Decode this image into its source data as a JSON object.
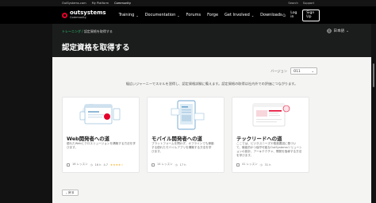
{
  "topbar": {
    "links": [
      "OutSystems.com",
      "My Platform",
      "Community"
    ],
    "right_links": [
      "Search",
      "Support"
    ]
  },
  "nav": {
    "logo_name": "outsystems",
    "logo_sub": "Community",
    "items": [
      {
        "label": "Training",
        "has_dropdown": true
      },
      {
        "label": "Documentation",
        "has_dropdown": true
      },
      {
        "label": "Forums",
        "has_dropdown": false
      },
      {
        "label": "Forge",
        "has_dropdown": false
      },
      {
        "label": "Get Involved",
        "has_dropdown": true
      },
      {
        "label": "Downloads",
        "has_dropdown": false
      }
    ],
    "login": "Log in",
    "signup": "Sign Up"
  },
  "subheader": {
    "breadcrumb_link": "トレーニング",
    "breadcrumb_sep": "/",
    "breadcrumb_current": "認定資格を取得する",
    "language": "日本語",
    "title": "認定資格を取得する"
  },
  "filter": {
    "label": "バージョン",
    "value": "O11"
  },
  "intro": "幅広いジャーニーでスキルを習得し、認定資格試験に備えます。認定資格の取得は社内外での評価につながります。",
  "cards": [
    {
      "title": "Web開発者への道",
      "desc": [
        "優れたWebとクロスリュージョンを構築する方法を学",
        "びます。"
      ],
      "meta1": "16 レッスン",
      "meta2": "16 h",
      "stars": "★★★★☆",
      "rating": "4.7"
    },
    {
      "title": "モバイル開発者への道",
      "desc": [
        "プラットフォームを問わず、オフラインでも稼動",
        "する優れたモバイルアプリを構築する方法を学",
        "びます。"
      ],
      "meta1": "14 レッスン",
      "meta2": "17 h"
    },
    {
      "title": "テックリードへの道",
      "desc": [
        "ここでは、ビジネスニーズや推進要因に基づい",
        "て、機能的かつ保守可能なOutSystemsソリューシ",
        "ョンの設計、アーキテクチャ、開発を指導する方法",
        "を学びます。"
      ],
      "meta1": "41 レッスン",
      "meta2": "31 h"
    }
  ],
  "back_button": "戻る",
  "colors": {
    "brand_red": "#e4002b",
    "accent_green": "#2fd97a"
  }
}
